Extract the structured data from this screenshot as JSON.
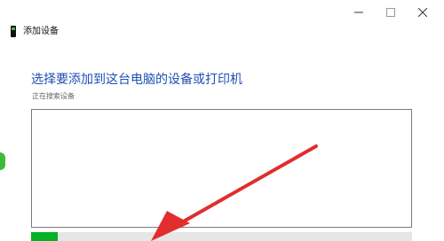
{
  "window": {
    "title": "添加设备",
    "title_icon": "device-icon",
    "controls": {
      "minimize": "minimize-icon",
      "maximize": "maximize-icon",
      "close": "close-icon"
    }
  },
  "main": {
    "heading": "选择要添加到这台电脑的设备或打印机",
    "status": "正在搜索设备",
    "progress": 0.07
  },
  "colors": {
    "heading": "#1f4fb4",
    "progress": "#06b025",
    "arrow": "#e12d2d"
  }
}
